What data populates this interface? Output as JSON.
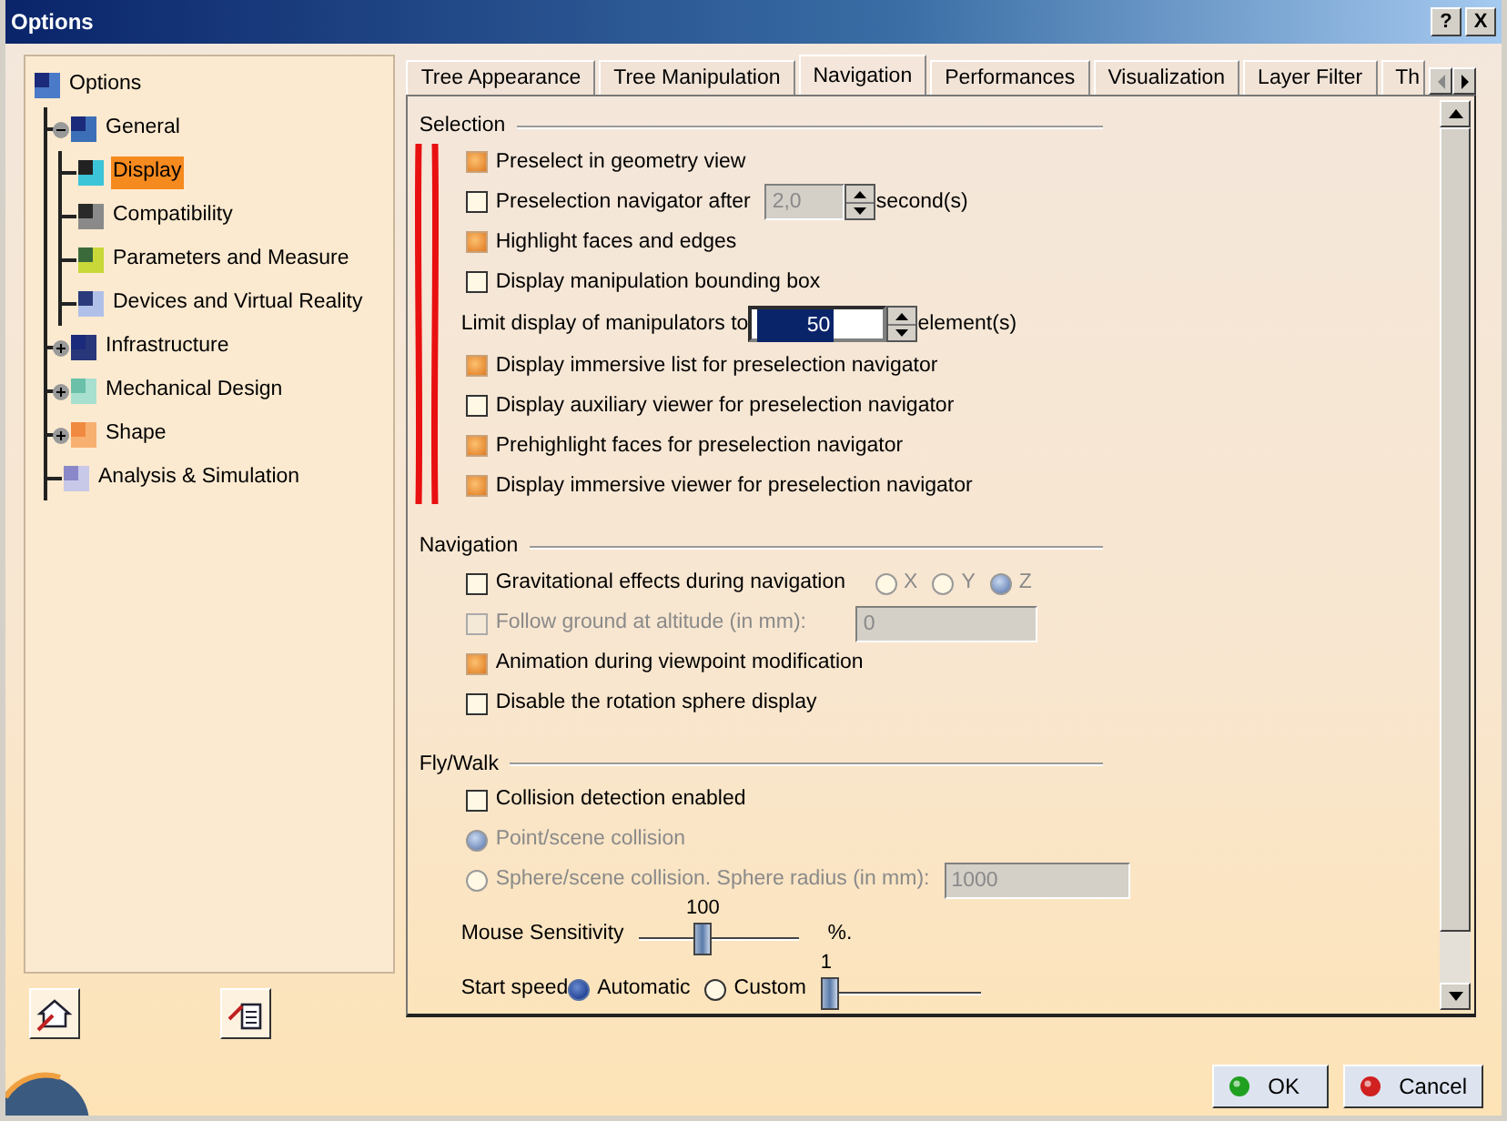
{
  "window": {
    "title": "Options",
    "title_buttons": [
      "?",
      "X"
    ]
  },
  "tree": {
    "label": "Options",
    "selected": false,
    "children": [
      {
        "label": "General",
        "selected": false,
        "expanded": true,
        "children": [
          {
            "label": "Display",
            "selected": true
          },
          {
            "label": "Compatibility",
            "selected": false
          },
          {
            "label": "Parameters and Measure",
            "selected": false
          },
          {
            "label": "Devices and Virtual Reality",
            "selected": false
          }
        ]
      },
      {
        "label": "Infrastructure",
        "selected": false,
        "expanded": false
      },
      {
        "label": "Mechanical Design",
        "selected": false,
        "expanded": false
      },
      {
        "label": "Shape",
        "selected": false,
        "expanded": false
      },
      {
        "label": "Analysis & Simulation",
        "selected": false
      }
    ]
  },
  "tabs": [
    {
      "label": "Tree Appearance",
      "selected": false
    },
    {
      "label": "Tree Manipulation",
      "selected": false
    },
    {
      "label": "Navigation",
      "selected": true
    },
    {
      "label": "Performances",
      "selected": false
    },
    {
      "label": "Visualization",
      "selected": false
    },
    {
      "label": "Layer Filter",
      "selected": false
    },
    {
      "label": "Th",
      "selected": false
    }
  ],
  "sections": [
    {
      "title": "Selection",
      "items": [
        {
          "kind": "checkbox",
          "label": "Preselect in geometry view",
          "checked": true,
          "disabled": false
        },
        {
          "kind": "checkspin",
          "label": "Preselection navigator after",
          "checked": false,
          "disabled": false,
          "value": "2,0",
          "field_disabled": true,
          "unit": "second(s)"
        },
        {
          "kind": "checkbox",
          "label": "Highlight faces and edges",
          "checked": true,
          "disabled": false
        },
        {
          "kind": "checkbox",
          "label": "Display manipulation bounding box",
          "checked": false,
          "disabled": false
        },
        {
          "kind": "number",
          "label": "Limit display of manipulators to",
          "value": "50",
          "value_selected": true,
          "unit": "element(s)"
        },
        {
          "kind": "checkbox",
          "label": "Display immersive list for preselection navigator",
          "checked": true,
          "disabled": false
        },
        {
          "kind": "checkbox",
          "label": "Display auxiliary viewer for preselection navigator",
          "checked": false,
          "disabled": false
        },
        {
          "kind": "checkbox",
          "label": "Prehighlight faces for preselection navigator",
          "checked": true,
          "disabled": false
        },
        {
          "kind": "checkbox",
          "label": "Display immersive viewer for preselection navigator",
          "checked": true,
          "disabled": false
        }
      ]
    },
    {
      "title": "Navigation",
      "items": [
        {
          "kind": "checkradios",
          "label": "Gravitational effects during navigation",
          "checked": false,
          "disabled": false,
          "options_disabled": true,
          "options": [
            {
              "label": "X",
              "selected": false
            },
            {
              "label": "Y",
              "selected": false
            },
            {
              "label": "Z",
              "selected": true
            }
          ]
        },
        {
          "kind": "checkfield",
          "label": "Follow ground at altitude (in mm):",
          "checked": false,
          "disabled": true,
          "value": "0"
        },
        {
          "kind": "checkbox",
          "label": "Animation during viewpoint modification",
          "checked": true,
          "disabled": false
        },
        {
          "kind": "checkbox",
          "label": "Disable the rotation sphere display",
          "checked": false,
          "disabled": false
        }
      ]
    },
    {
      "title": "Fly/Walk",
      "items": [
        {
          "kind": "checkbox",
          "label": "Collision detection enabled",
          "checked": false,
          "disabled": false
        },
        {
          "kind": "radio",
          "label": "Point/scene collision",
          "selected": true,
          "disabled": true
        },
        {
          "kind": "radiofield",
          "label": "Sphere/scene collision. Sphere radius (in mm):",
          "selected": false,
          "disabled": true,
          "value": "1000"
        },
        {
          "kind": "slider",
          "label": "Mouse Sensitivity",
          "value_label": "100",
          "level": 0.39,
          "unit": "%."
        },
        {
          "kind": "speed",
          "label": "Start speed",
          "options": [
            {
              "label": "Automatic",
              "selected": true
            },
            {
              "label": "Custom",
              "selected": false
            }
          ],
          "value_label": "1",
          "level": 0
        }
      ]
    }
  ],
  "buttons": [
    {
      "kind": "ok",
      "label": "OK"
    },
    {
      "kind": "cancel",
      "label": "Cancel"
    }
  ]
}
